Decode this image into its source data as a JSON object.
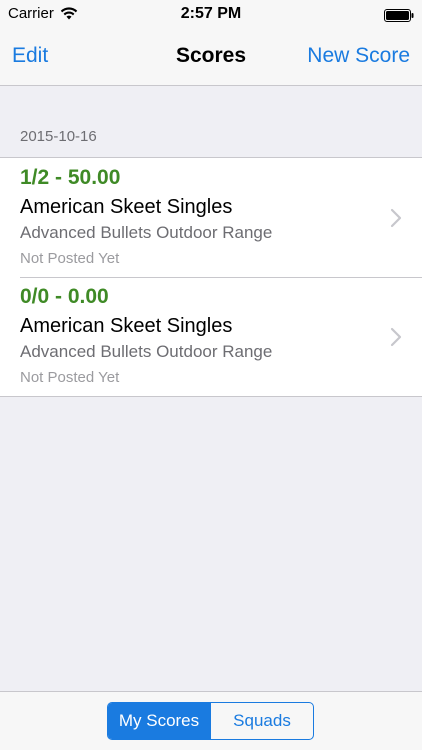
{
  "status_bar": {
    "carrier": "Carrier",
    "time": "2:57 PM"
  },
  "nav": {
    "left_label": "Edit",
    "title": "Scores",
    "right_label": "New Score"
  },
  "section": {
    "date": "2015-10-16"
  },
  "scores": [
    {
      "score": "1/2 - 50.00",
      "title": "American Skeet Singles",
      "location": "Advanced Bullets Outdoor Range",
      "status": "Not Posted Yet"
    },
    {
      "score": "0/0 - 0.00",
      "title": "American Skeet Singles",
      "location": "Advanced Bullets Outdoor Range",
      "status": "Not Posted Yet"
    }
  ],
  "segments": {
    "my_scores": "My Scores",
    "squads": "Squads",
    "selected": "My Scores"
  },
  "colors": {
    "accent": "#1a7be0",
    "score_green": "#3f8a26",
    "background": "#efeff4"
  },
  "icons": [
    "wifi-icon",
    "battery-icon",
    "chevron-right-icon"
  ]
}
